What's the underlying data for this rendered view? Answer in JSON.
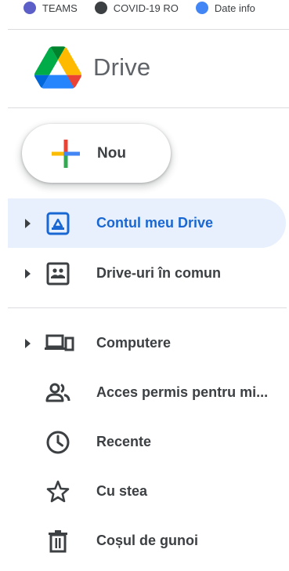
{
  "bookmarks": [
    {
      "label": "TEAMS",
      "color": "#5b5fc7"
    },
    {
      "label": "COVID-19 RO",
      "color": "#3c4043"
    },
    {
      "label": "Date info",
      "color": "#4285f4"
    }
  ],
  "header": {
    "title": "Drive",
    "logo_icon": "google-drive-logo"
  },
  "new_button": {
    "label": "Nou",
    "icon": "plus-icon"
  },
  "nav": {
    "primary": [
      {
        "label": "Contul meu Drive",
        "icon": "my-drive-icon",
        "expandable": true,
        "active": true
      },
      {
        "label": "Drive-uri în comun",
        "icon": "shared-drives-icon",
        "expandable": true,
        "active": false
      }
    ],
    "secondary": [
      {
        "label": "Computere",
        "icon": "computers-icon",
        "expandable": true
      },
      {
        "label": "Acces permis pentru mi...",
        "icon": "shared-with-me-icon",
        "expandable": false
      },
      {
        "label": "Recente",
        "icon": "clock-icon",
        "expandable": false
      },
      {
        "label": "Cu stea",
        "icon": "star-icon",
        "expandable": false
      },
      {
        "label": "Coșul de gunoi",
        "icon": "trash-icon",
        "expandable": false
      }
    ]
  },
  "colors": {
    "active_bg": "#e8f0fe",
    "active_text": "#1967d2",
    "text": "#3c4043",
    "divider": "#dadce0",
    "google_blue": "#4285f4",
    "google_red": "#ea4335",
    "google_yellow": "#fbbc04",
    "google_green": "#34a853"
  }
}
